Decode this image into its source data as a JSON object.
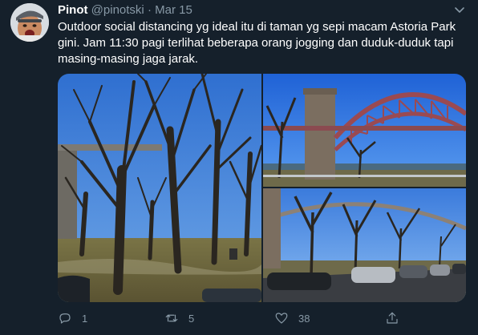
{
  "tweet": {
    "author_name": "Pinot",
    "author_handle": "@pinotski",
    "separator": "·",
    "date": "Mar 15",
    "text": "Outdoor social distancing yg ideal itu di taman yg sepi macam Astoria Park gini. Jam 11:30 pagi terlihat beberapa orang jogging dan duduk-duduk tapi masing-masing jaga jarak."
  },
  "actions": {
    "reply_count": "1",
    "retweet_count": "5",
    "like_count": "38"
  },
  "icons": {
    "more": "chevron-down-icon",
    "reply": "reply-icon",
    "retweet": "retweet-icon",
    "like": "heart-icon",
    "share": "share-icon"
  },
  "colors": {
    "background": "#15202b",
    "secondary_text": "#8899a6",
    "primary_text": "#ffffff"
  }
}
